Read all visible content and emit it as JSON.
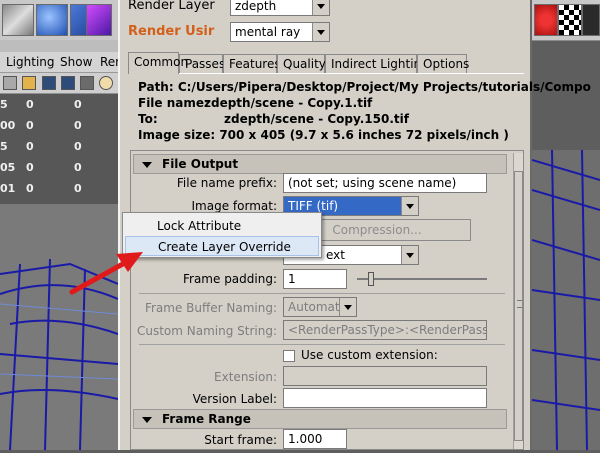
{
  "window": {
    "render_layer_label": "Render Layer",
    "render_layer_value": "zdepth",
    "render_using_label": "Render Usir",
    "render_using_value": "mental ray"
  },
  "tabs": [
    "Common",
    "Passes",
    "Features",
    "Quality",
    "Indirect Lighting",
    "Options"
  ],
  "info": {
    "path": "Path: C:/Users/Pipera/Desktop/Project/My Projects/tutorials/Compo",
    "file_name_label": "File name:",
    "file_name": "zdepth/scene - Copy.1.tif",
    "to_label": "To:",
    "to": "zdepth/scene - Copy.150.tif",
    "image_size": "Image size: 700 x 405 (9.7 x 5.6 inches 72 pixels/inch )"
  },
  "file_output": {
    "title": "File Output",
    "prefix_label": "File name prefix:",
    "prefix_value": "(not set; using scene name)",
    "format_label": "Image format:",
    "format_value": "TIFF (tif)",
    "compression_label": "Compression...",
    "frame_ext_value": "ext",
    "padding_label": "Frame padding:",
    "padding_value": "1",
    "buffer_naming_label": "Frame Buffer Naming:",
    "buffer_naming_value": "Automatic",
    "custom_naming_label": "Custom Naming String:",
    "custom_naming_value": "<RenderPassType>:<RenderPass>.<Came",
    "custom_ext_label": "Use custom extension:",
    "extension_label": "Extension:",
    "version_label": "Version Label:"
  },
  "frame_range": {
    "title": "Frame Range",
    "start_label": "Start frame:",
    "start_value": "1.000"
  },
  "context_menu": {
    "lock": "Lock Attribute",
    "override": "Create Layer Override"
  },
  "bg": {
    "menu_lighting": "Lighting",
    "menu_show": "Show",
    "menu_ren": "Ren",
    "channel_rows": [
      {
        "a": "5",
        "b": "0",
        "c": "0"
      },
      {
        "a": "00",
        "b": "0",
        "c": "0"
      },
      {
        "a": "5",
        "b": "0",
        "c": "0"
      },
      {
        "a": "05",
        "b": "0",
        "c": "0"
      },
      {
        "a": "01",
        "b": "0",
        "c": "0"
      }
    ]
  },
  "colors": {
    "orange_label": "#d2601a",
    "selection_blue": "#3569c6",
    "wireframe": "#1a1aa8",
    "arrow_red": "#e01a1a"
  },
  "icons": [
    "cube-icon",
    "sphere-icon",
    "checker-icon",
    "render-icon"
  ]
}
